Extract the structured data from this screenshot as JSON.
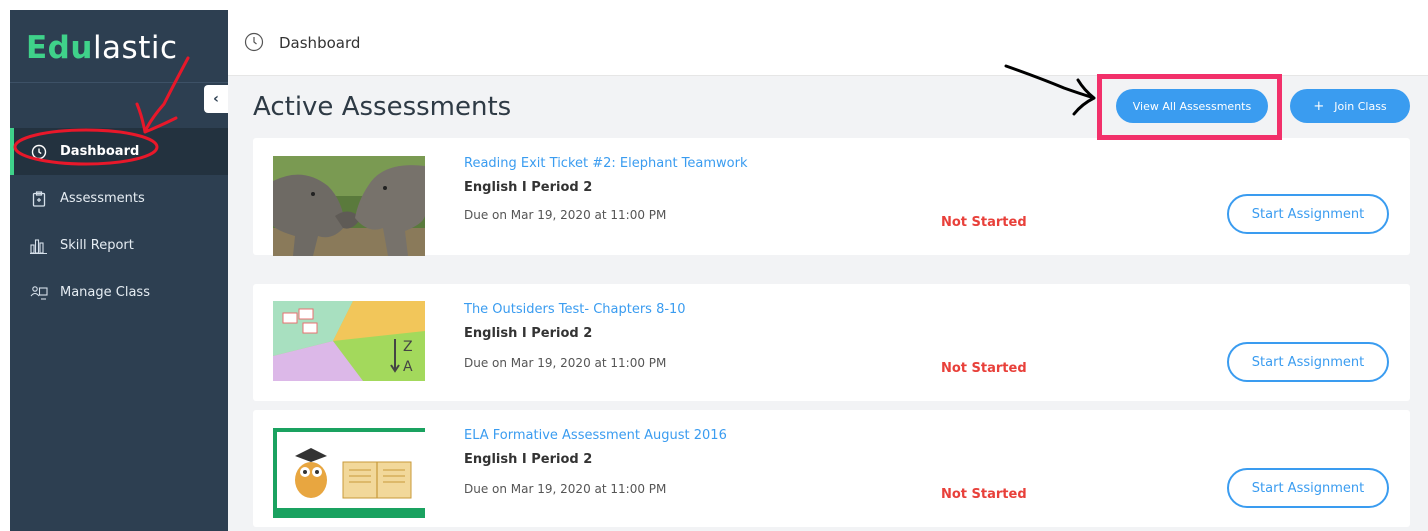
{
  "sidebar": {
    "logo_edu": "Edu",
    "logo_rest": "lastic",
    "collapse_label": "‹",
    "items": [
      {
        "label": "Dashboard",
        "icon": "clock-icon",
        "active": true
      },
      {
        "label": "Assessments",
        "icon": "clipboard-icon",
        "active": false
      },
      {
        "label": "Skill Report",
        "icon": "bar-chart-icon",
        "active": false
      },
      {
        "label": "Manage Class",
        "icon": "class-icon",
        "active": false
      }
    ]
  },
  "header": {
    "title": "Dashboard",
    "icon": "clock-icon"
  },
  "main": {
    "title": "Active Assessments",
    "view_all_label": "View All Assessments",
    "join_class_plus": "+",
    "join_class_label": "Join Class",
    "assignments": [
      {
        "title": "Reading Exit Ticket #2: Elephant Teamwork",
        "class": "English I Period 2",
        "due": "Due on Mar 19, 2020  at 11:00 PM",
        "status": "Not Started",
        "button": "Start Assignment",
        "thumbnail": "elephant-photo"
      },
      {
        "title": "The Outsiders Test- Chapters 8-10",
        "class": "English I Period 2",
        "due": "Due on Mar 19, 2020  at 11:00 PM",
        "status": "Not Started",
        "button": "Start Assignment",
        "thumbnail": "sort-za-illustration"
      },
      {
        "title": "ELA Formative Assessment August 2016",
        "class": "English I Period 2",
        "due": "Due on Mar 19, 2020  at 11:00 PM",
        "status": "Not Started",
        "button": "Start Assignment",
        "thumbnail": "owl-book-illustration"
      }
    ]
  },
  "colors": {
    "sidebar_bg": "#2d3f51",
    "accent_green": "#3fd28a",
    "primary_blue": "#3a9cf0",
    "status_red": "#e8403a",
    "annotation_red": "#e8182a",
    "highlight_pink": "#f2306a"
  }
}
